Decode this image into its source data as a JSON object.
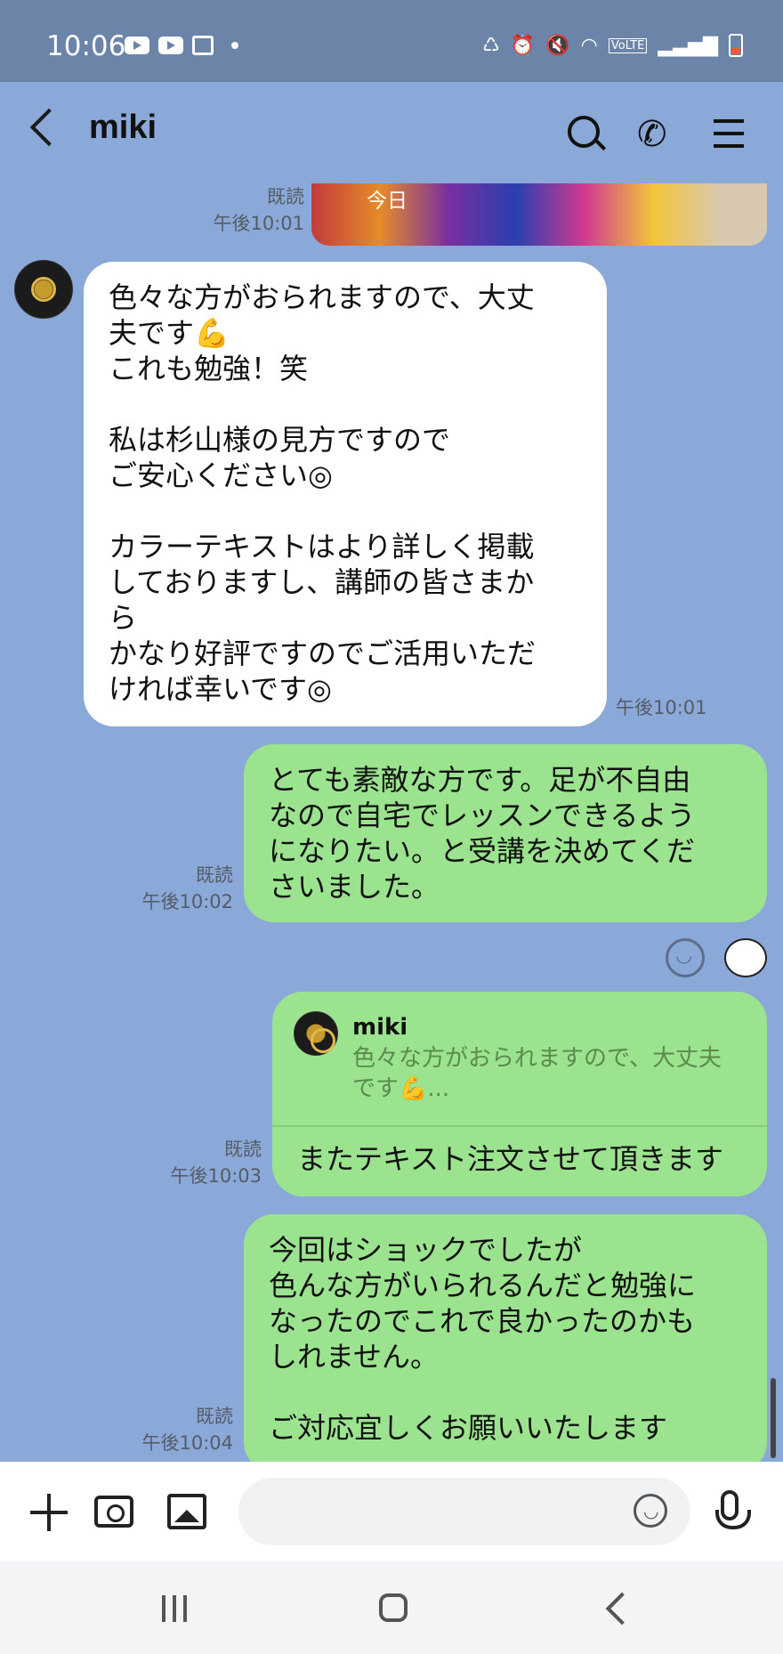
{
  "status_bar": {
    "time": "10:06",
    "left_icons": [
      "youtube-icon",
      "youtube-icon",
      "image-icon",
      "dot"
    ],
    "right_icons": [
      "nfc-icon",
      "alarm-icon",
      "mute-icon",
      "wifi-icon",
      "volte-icon",
      "signal-icon",
      "battery-low-icon"
    ]
  },
  "header": {
    "title": "miki",
    "actions": [
      "search-icon",
      "phone-icon",
      "menu-icon"
    ]
  },
  "messages": [
    {
      "id": "m0",
      "side": "right",
      "type": "image",
      "overlay_text": "今日",
      "read": "既読",
      "time": "午後10:01"
    },
    {
      "id": "m1",
      "side": "left",
      "type": "text",
      "lines": [
        "色々な方がおられますので、大丈",
        "夫です💪",
        "これも勉強！笑",
        "",
        "私は杉山様の見方ですので",
        "ご安心ください◎",
        "",
        "カラーテキストはより詳しく掲載",
        "しておりますし、講師の皆さまか",
        "ら",
        "かなり好評ですのでご活用いただ",
        "ければ幸いです◎"
      ],
      "time": "午後10:01"
    },
    {
      "id": "m2",
      "side": "right",
      "type": "text",
      "lines": [
        "とても素敵な方です。足が不自由",
        "なので自宅でレッスンできるよう",
        "になりたい。と受講を決めてくだ",
        "さいました。"
      ],
      "read": "既読",
      "time": "午後10:02"
    },
    {
      "id": "m3",
      "side": "right",
      "type": "reply",
      "reply_to": {
        "name": "miki",
        "lines": [
          "色々な方がおられますので、大丈夫",
          "です💪..."
        ]
      },
      "text": "またテキスト注文させて頂きます",
      "read": "既読",
      "time": "午後10:03"
    },
    {
      "id": "m4",
      "side": "right",
      "type": "text",
      "lines": [
        "今回はショックでしたが",
        "色んな方がいられるんだと勉強に",
        "なったのでこれで良かったのかも",
        "しれません。",
        "",
        "ご対応宜しくお願いいたします"
      ],
      "read": "既読",
      "time": "午後10:04"
    }
  ],
  "input_bar": {
    "icons": [
      "plus-icon",
      "camera-icon",
      "image-icon",
      "emoji-icon",
      "mic-icon"
    ],
    "placeholder": ""
  },
  "nav_bar": [
    "recent-apps",
    "home",
    "back"
  ]
}
